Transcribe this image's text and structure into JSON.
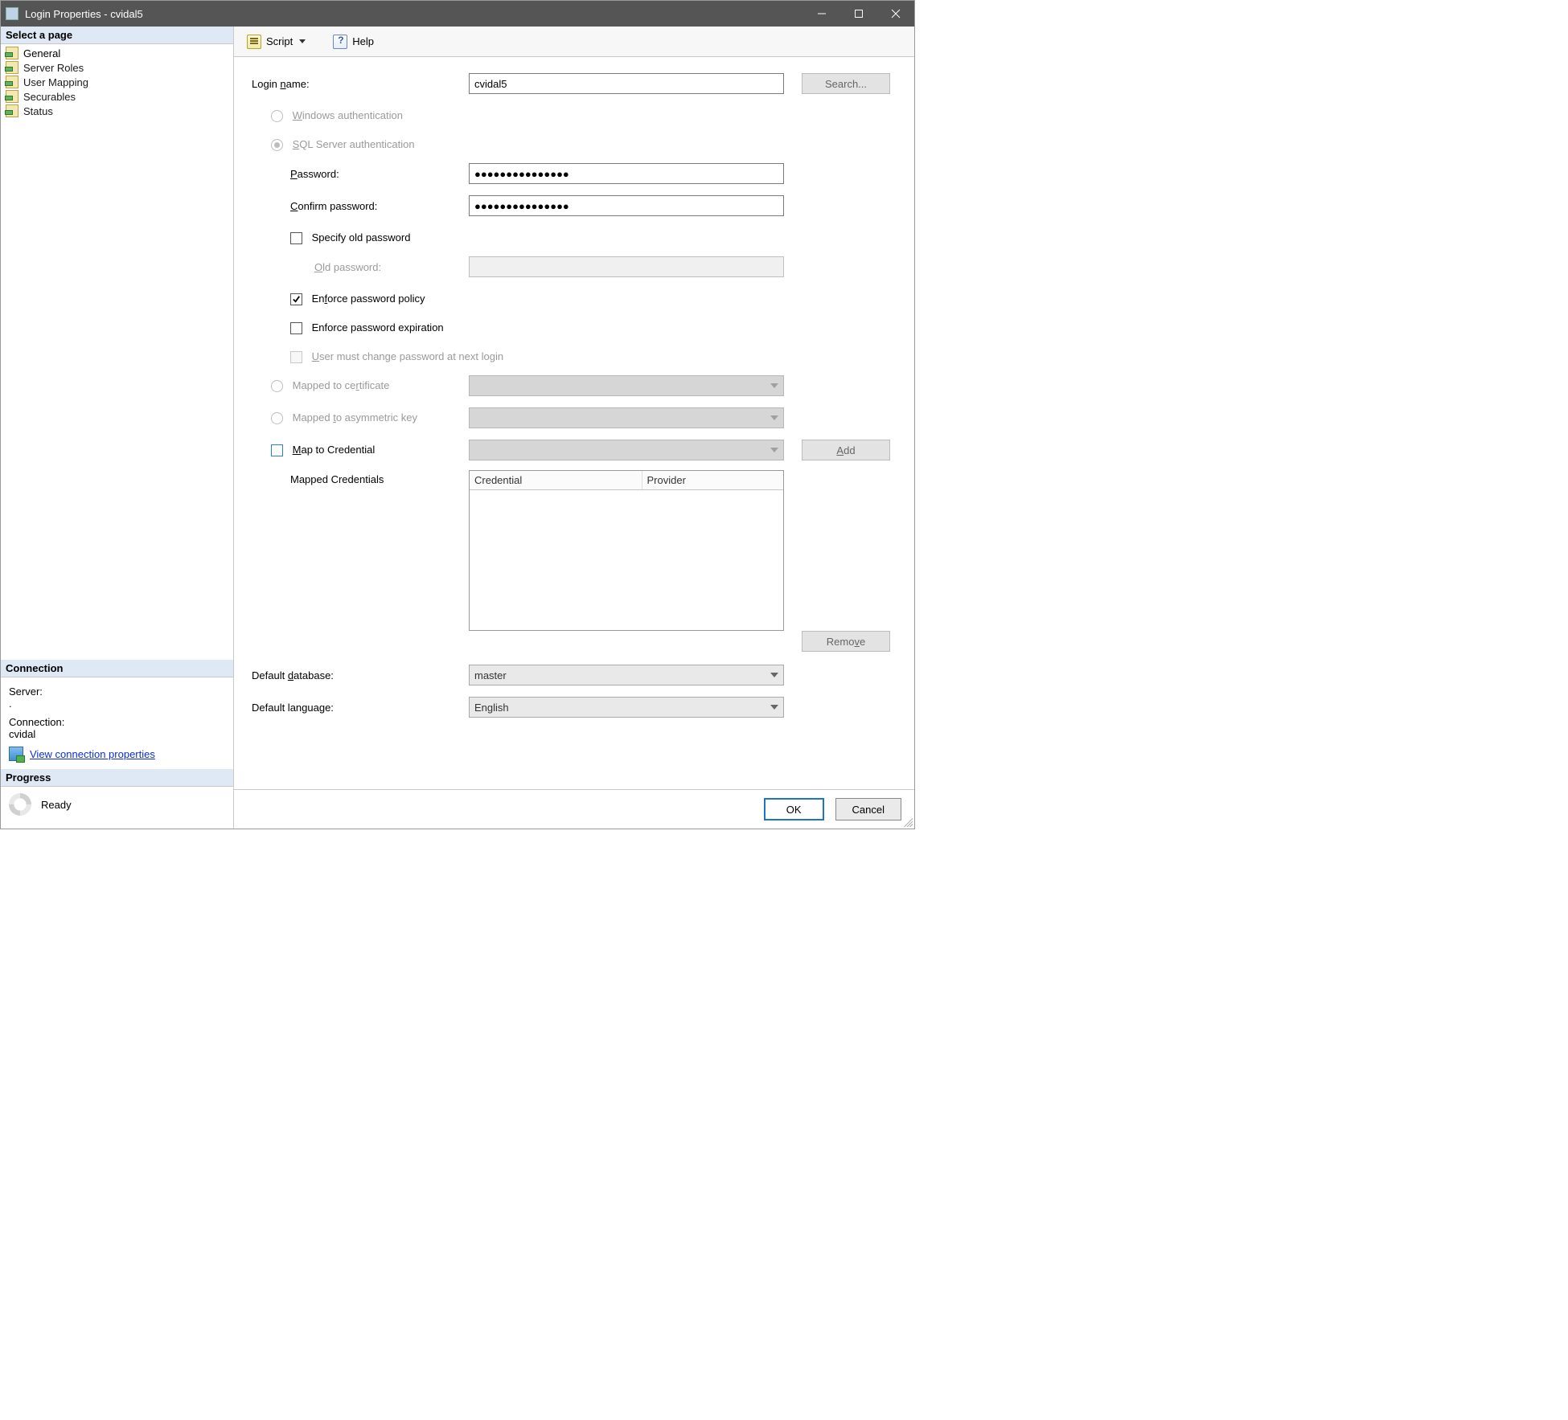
{
  "window": {
    "title": "Login Properties - cvidal5"
  },
  "sidebar": {
    "select_page_header": "Select a page",
    "pages": [
      {
        "label": "General",
        "selected": true
      },
      {
        "label": "Server Roles",
        "selected": false
      },
      {
        "label": "User Mapping",
        "selected": false
      },
      {
        "label": "Securables",
        "selected": false
      },
      {
        "label": "Status",
        "selected": false
      }
    ],
    "connection_header": "Connection",
    "server_label": "Server:",
    "server_value": ".",
    "connection_label": "Connection:",
    "connection_value": "cvidal",
    "view_conn_props": "View connection properties",
    "progress_header": "Progress",
    "progress_status": "Ready"
  },
  "toolbar": {
    "script": "Script",
    "help": "Help"
  },
  "form": {
    "login_name_label": "Login name:",
    "login_name_value": "cvidal5",
    "search_btn": "Search...",
    "windows_auth": "Windows authentication",
    "sql_auth": "SQL Server authentication",
    "password_label": "Password:",
    "password_value": "●●●●●●●●●●●●●●●",
    "confirm_label": "Confirm password:",
    "confirm_value": "●●●●●●●●●●●●●●●",
    "specify_old": "Specify old password",
    "old_pw_label": "Old password:",
    "old_pw_value": "",
    "enforce_policy": "Enforce password policy",
    "enforce_expiration": "Enforce password expiration",
    "must_change": "User must change password at next login",
    "mapped_cert": "Mapped to certificate",
    "mapped_asym": "Mapped to asymmetric key",
    "map_cred": "Map to Credential",
    "add_btn": "Add",
    "mapped_credentials": "Mapped Credentials",
    "cred_col1": "Credential",
    "cred_col2": "Provider",
    "remove_btn": "Remove",
    "default_db_label": "Default database:",
    "default_db_value": "master",
    "default_lang_label": "Default language:",
    "default_lang_value": "English"
  },
  "footer": {
    "ok": "OK",
    "cancel": "Cancel"
  }
}
